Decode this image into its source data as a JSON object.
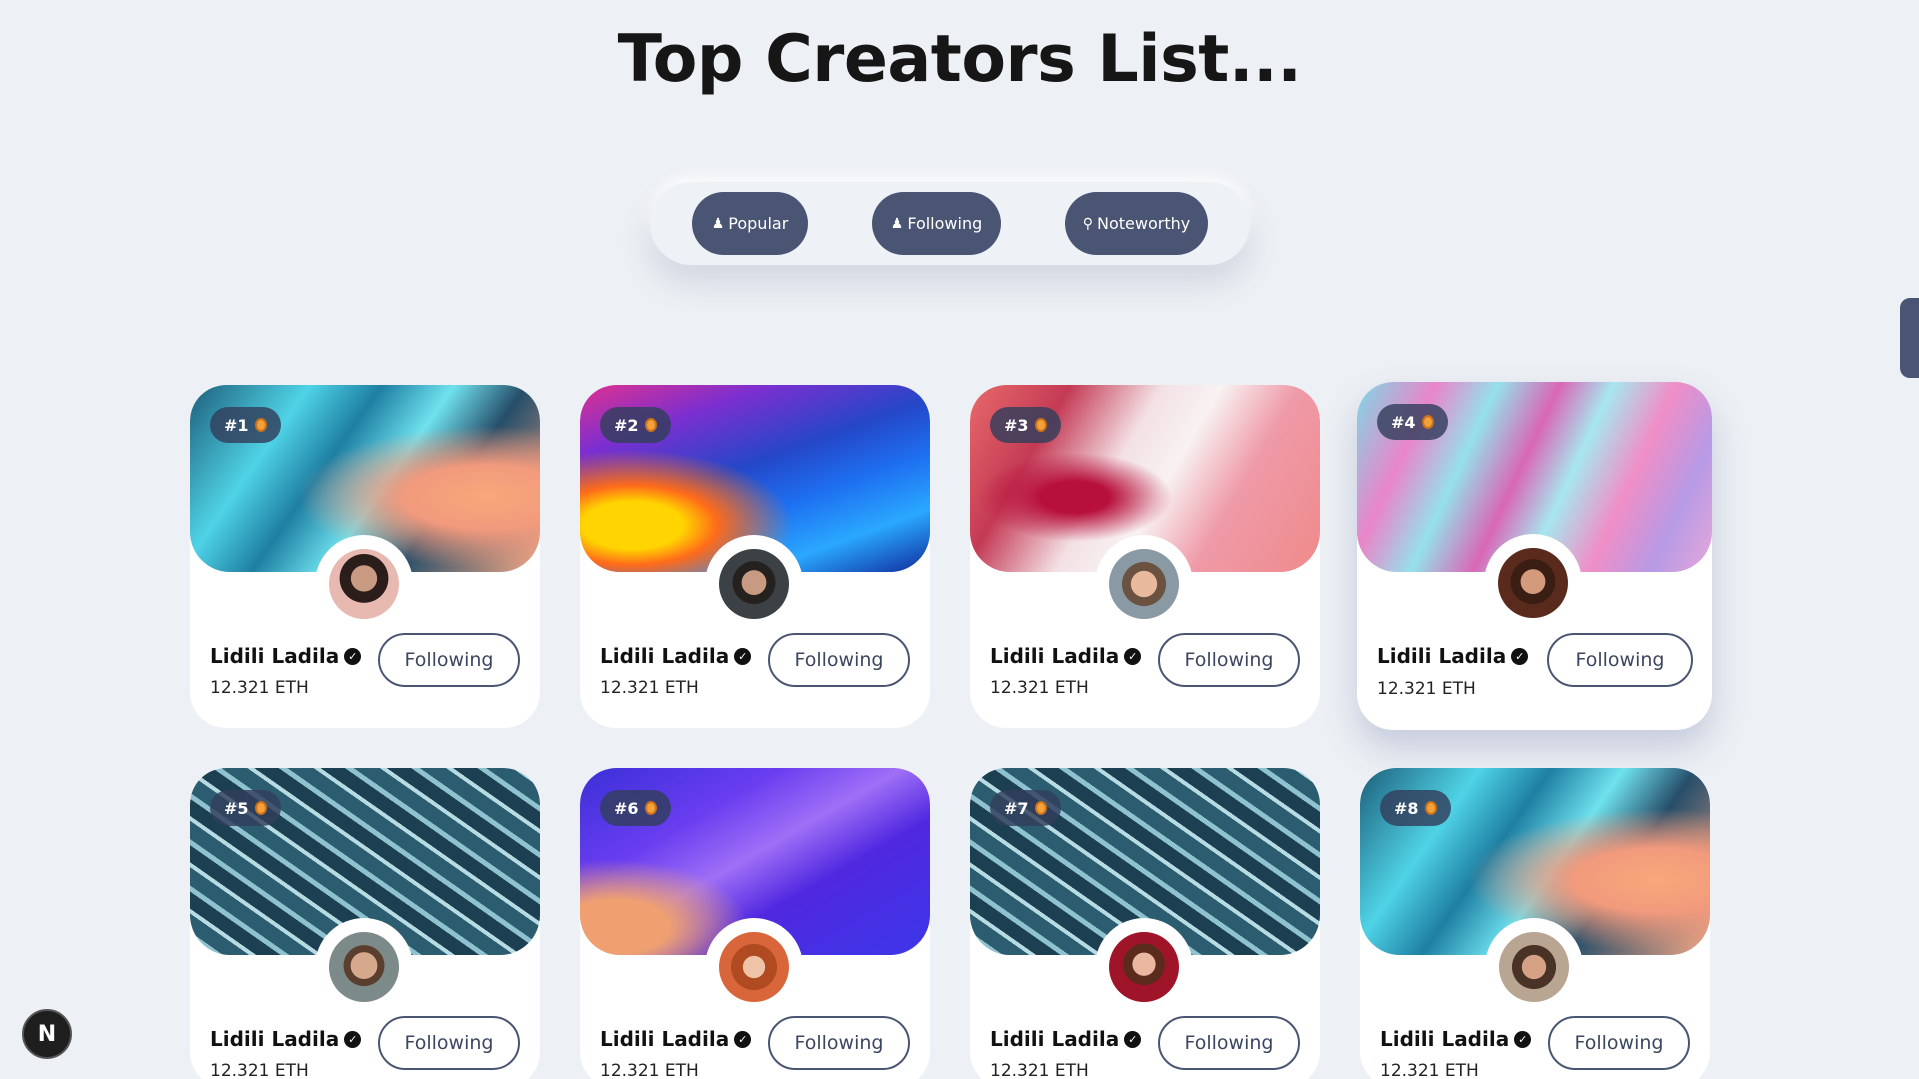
{
  "page": {
    "title": "Top Creators List..."
  },
  "tabs": [
    {
      "label": "Popular",
      "icon": "user-star-icon"
    },
    {
      "label": "Following",
      "icon": "user-check-icon"
    },
    {
      "label": "Noteworthy",
      "icon": "award-icon"
    }
  ],
  "cards": [
    {
      "rank": "#1",
      "name": "Lidili Ladila",
      "amount": "12.321 ETH",
      "button": "Following"
    },
    {
      "rank": "#2",
      "name": "Lidili Ladila",
      "amount": "12.321 ETH",
      "button": "Following"
    },
    {
      "rank": "#3",
      "name": "Lidili Ladila",
      "amount": "12.321 ETH",
      "button": "Following"
    },
    {
      "rank": "#4",
      "name": "Lidili Ladila",
      "amount": "12.321 ETH",
      "button": "Following"
    },
    {
      "rank": "#5",
      "name": "Lidili Ladila",
      "amount": "12.321 ETH",
      "button": "Following"
    },
    {
      "rank": "#6",
      "name": "Lidili Ladila",
      "amount": "12.321 ETH",
      "button": "Following"
    },
    {
      "rank": "#7",
      "name": "Lidili Ladila",
      "amount": "12.321 ETH",
      "button": "Following"
    },
    {
      "rank": "#8",
      "name": "Lidili Ladila",
      "amount": "12.321 ETH",
      "button": "Following"
    }
  ],
  "badge": {
    "label": "N"
  },
  "colors": {
    "accent": "#4a5573",
    "background": "#edf0f4"
  }
}
